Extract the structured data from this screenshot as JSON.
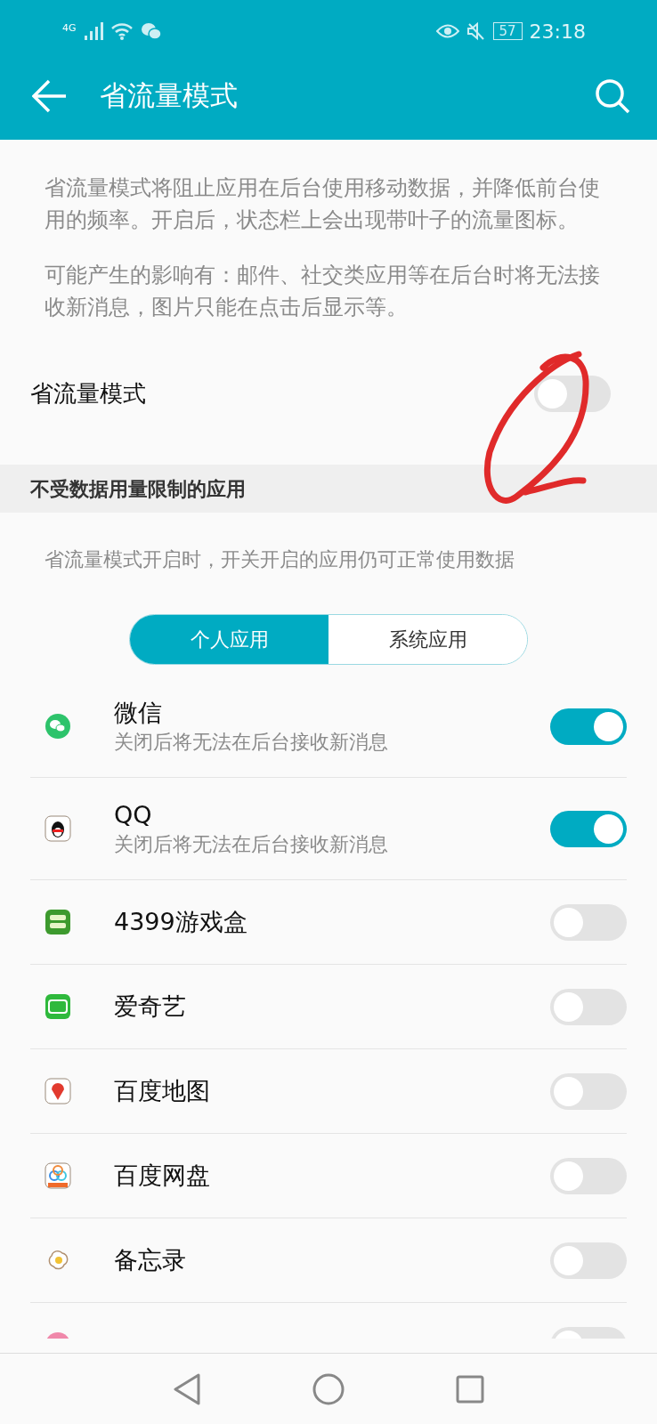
{
  "status_bar": {
    "network": "4G",
    "battery": "57",
    "time": "23:18"
  },
  "toolbar": {
    "title": "省流量模式"
  },
  "description": [
    "省流量模式将阻止应用在后台使用移动数据，并降低前台使用的频率。开启后，状态栏上会出现带叶子的流量图标。",
    "可能产生的影响有：邮件、社交类应用等在后台时将无法接收新消息，图片只能在点击后显示等。"
  ],
  "main_switch": {
    "label": "省流量模式",
    "on": false
  },
  "section": {
    "title": "不受数据用量限制的应用",
    "hint": "省流量模式开启时，开关开启的应用仍可正常使用数据"
  },
  "tabs": [
    {
      "label": "个人应用",
      "selected": true
    },
    {
      "label": "系统应用",
      "selected": false
    }
  ],
  "apps": [
    {
      "name": "微信",
      "subtitle": "关闭后将无法在后台接收新消息",
      "on": true
    },
    {
      "name": "QQ",
      "subtitle": "关闭后将无法在后台接收新消息",
      "on": true
    },
    {
      "name": "4399游戏盒",
      "on": false
    },
    {
      "name": "爱奇艺",
      "on": false
    },
    {
      "name": "百度地图",
      "on": false
    },
    {
      "name": "百度网盘",
      "on": false
    },
    {
      "name": "备忘录",
      "on": false
    },
    {
      "on": false
    }
  ]
}
